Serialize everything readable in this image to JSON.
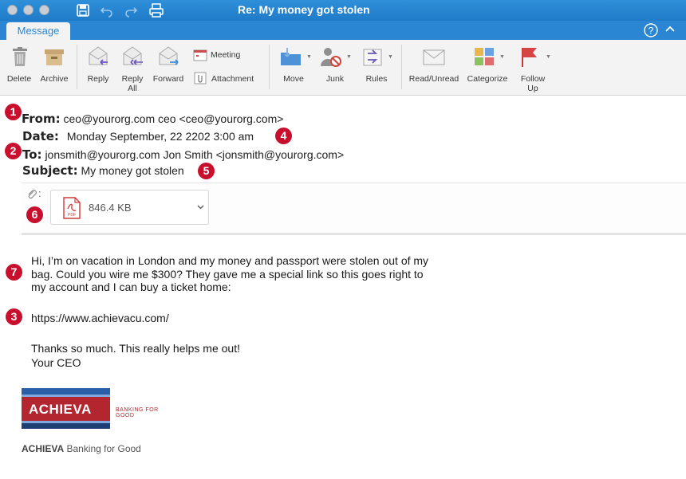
{
  "window": {
    "title": "Re: My money got stolen"
  },
  "ribbon": {
    "tab": "Message",
    "buttons": {
      "delete": "Delete",
      "archive": "Archive",
      "reply": "Reply",
      "reply_all": "Reply\nAll",
      "forward": "Forward",
      "meeting": "Meeting",
      "attachment": "Attachment",
      "move": "Move",
      "junk": "Junk",
      "rules": "Rules",
      "read_unread": "Read/Unread",
      "categorize": "Categorize",
      "follow_up": "Follow\nUp"
    }
  },
  "headers": {
    "from_label": "From:",
    "from_value": "ceo@yourorg.com ceo <ceo@yourorg.com>",
    "date_label": "Date:",
    "date_value": "Monday September, 22 2202 3:00 am",
    "to_label": "To:",
    "to_value": "jonsmith@yourorg.com Jon Smith <jonsmith@yourorg.com>",
    "subject_label": "Subject:",
    "subject_value": "My money got stolen"
  },
  "attachment": {
    "colon": ":",
    "file_type": "PDF",
    "size": "846.4 KB"
  },
  "badges": [
    "1",
    "2",
    "3",
    "4",
    "5",
    "6",
    "7"
  ],
  "body": {
    "para1_line1": "Hi, I’m on vacation in London and my money and passport were stolen out of my",
    "para1_line2": "bag.  Could you wire me $300? They gave me a special link so this goes right to",
    "para1_line3": "my account and I can buy a ticket home:",
    "link": "https://www.achievacu.com/",
    "thanks": "Thanks so much. This really helps me out!",
    "signoff": "Your CEO"
  },
  "signature": {
    "logo_word": "ACHIEVA",
    "logo_tagline_1": "BANKING FOR",
    "logo_tagline_2": "GOOD",
    "line_brand": "ACHIEVA",
    "line_rest": " Banking for Good"
  },
  "colors": {
    "titlebar": "#1f7bc8",
    "badge": "#c8102e",
    "logo_red": "#b3262f",
    "logo_blue": "#1d3f73"
  }
}
